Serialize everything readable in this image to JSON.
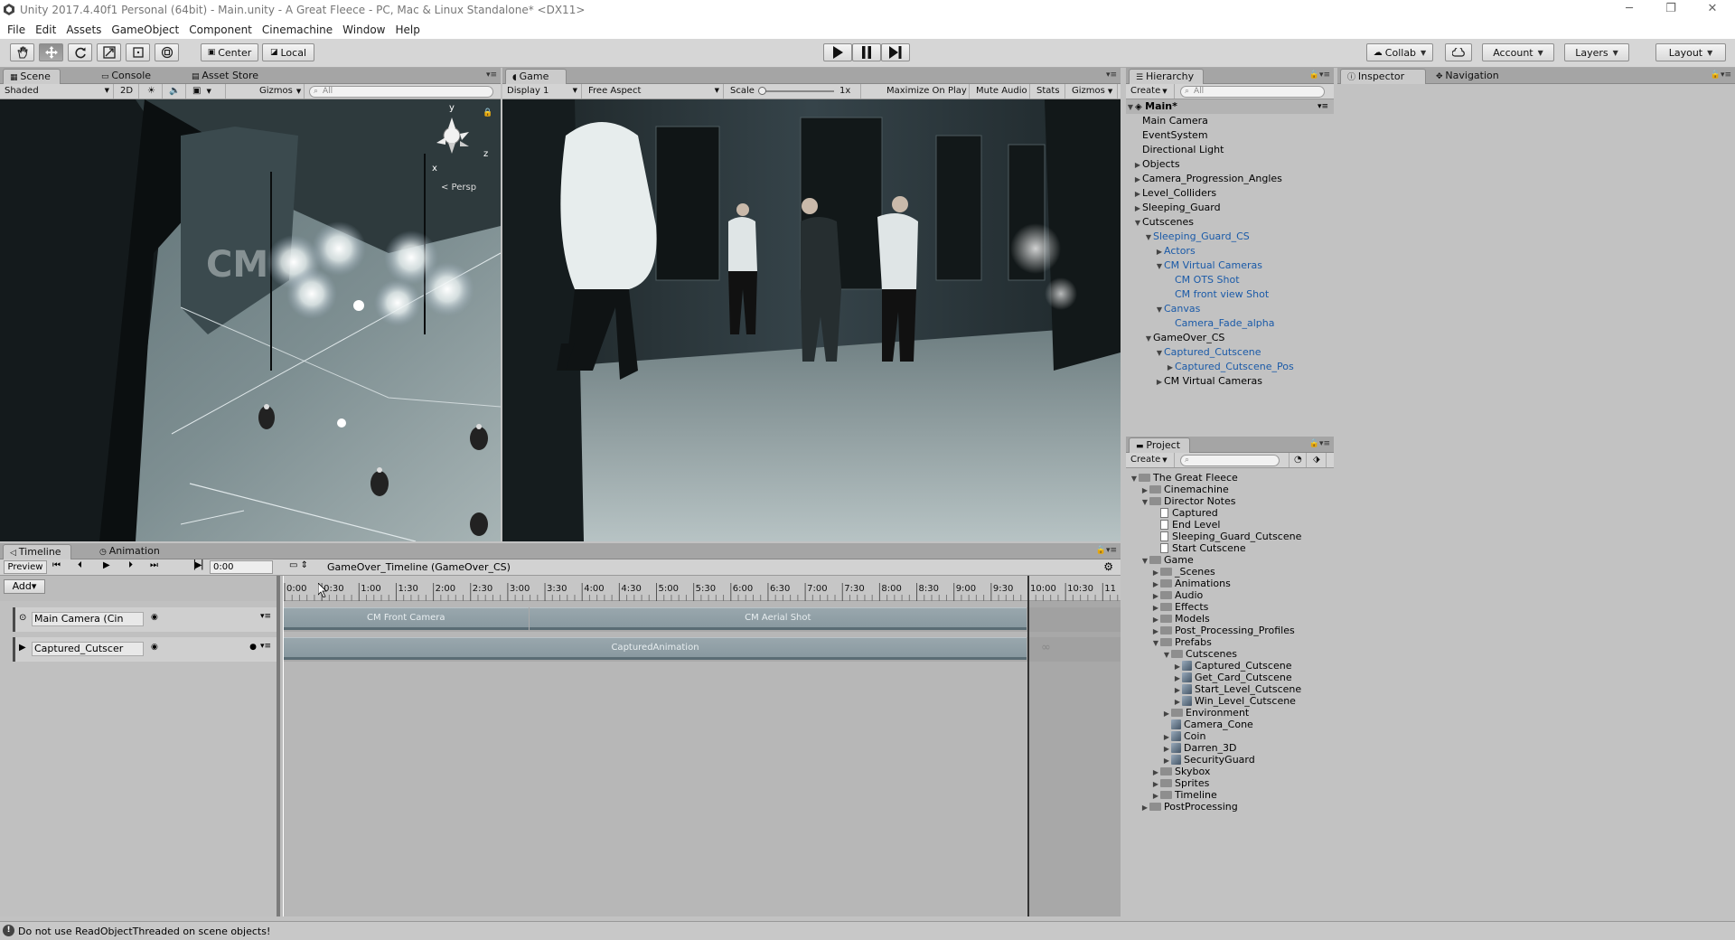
{
  "window": {
    "title": "Unity 2017.4.40f1 Personal (64bit) - Main.unity - A Great Fleece - PC, Mac & Linux Standalone* <DX11>",
    "minimize": "─",
    "restore": "❐",
    "close": "✕"
  },
  "menu": [
    "File",
    "Edit",
    "Assets",
    "GameObject",
    "Component",
    "Cinemachine",
    "Window",
    "Help"
  ],
  "toolbar": {
    "pivot": "Center",
    "space": "Local",
    "collab": "Collab",
    "account": "Account",
    "layers": "Layers",
    "layout": "Layout"
  },
  "scene": {
    "tabs": [
      "Scene",
      "Console",
      "Asset Store"
    ],
    "shading": "Shaded",
    "mode2d": "2D",
    "gizmos": "Gizmos",
    "search": "All",
    "persp": "< Persp",
    "axes": {
      "y": "y",
      "z": "z",
      "x": "x"
    },
    "logo": "CM"
  },
  "game": {
    "tab": "Game",
    "display": "Display 1",
    "aspect": "Free Aspect",
    "scale_label": "Scale",
    "scale_value": "1x",
    "scale_level": 0.05,
    "maximize": "Maximize On Play",
    "mute": "Mute Audio",
    "stats": "Stats",
    "gizmos": "Gizmos"
  },
  "hierarchy": {
    "tab": "Hierarchy",
    "create": "Create",
    "search": "All",
    "scene": "Main*",
    "items": [
      {
        "label": "Main Camera",
        "depth": 0,
        "arrow": "",
        "blue": false
      },
      {
        "label": "EventSystem",
        "depth": 0,
        "arrow": "",
        "blue": false
      },
      {
        "label": "Directional Light",
        "depth": 0,
        "arrow": "",
        "blue": false
      },
      {
        "label": "Objects",
        "depth": 0,
        "arrow": "▶",
        "blue": false
      },
      {
        "label": "Camera_Progression_Angles",
        "depth": 0,
        "arrow": "▶",
        "blue": false
      },
      {
        "label": "Level_Colliders",
        "depth": 0,
        "arrow": "▶",
        "blue": false
      },
      {
        "label": "Sleeping_Guard",
        "depth": 0,
        "arrow": "▶",
        "blue": false
      },
      {
        "label": "Cutscenes",
        "depth": 0,
        "arrow": "▼",
        "blue": false
      },
      {
        "label": "Sleeping_Guard_CS",
        "depth": 1,
        "arrow": "▼",
        "blue": true
      },
      {
        "label": "Actors",
        "depth": 2,
        "arrow": "▶",
        "blue": true
      },
      {
        "label": "CM Virtual Cameras",
        "depth": 2,
        "arrow": "▼",
        "blue": true
      },
      {
        "label": "CM OTS Shot",
        "depth": 3,
        "arrow": "",
        "blue": true
      },
      {
        "label": "CM front view Shot",
        "depth": 3,
        "arrow": "",
        "blue": true
      },
      {
        "label": "Canvas",
        "depth": 2,
        "arrow": "▼",
        "blue": true
      },
      {
        "label": "Camera_Fade_alpha",
        "depth": 3,
        "arrow": "",
        "blue": true
      },
      {
        "label": "GameOver_CS",
        "depth": 1,
        "arrow": "▼",
        "blue": false
      },
      {
        "label": "Captured_Cutscene",
        "depth": 2,
        "arrow": "▼",
        "blue": true
      },
      {
        "label": "Captured_Cutscene_Pos",
        "depth": 3,
        "arrow": "▶",
        "blue": true
      },
      {
        "label": "CM Virtual Cameras",
        "depth": 2,
        "arrow": "▶",
        "blue": false
      }
    ]
  },
  "inspector": {
    "tab": "Inspector",
    "nav_tab": "Navigation"
  },
  "project": {
    "tab": "Project",
    "create": "Create",
    "items": [
      {
        "label": "The Great Fleece",
        "depth": 0,
        "arrow": "▼",
        "icon": "folder"
      },
      {
        "label": "Cinemachine",
        "depth": 1,
        "arrow": "▶",
        "icon": "folder"
      },
      {
        "label": "Director Notes",
        "depth": 1,
        "arrow": "▼",
        "icon": "folder"
      },
      {
        "label": "Captured",
        "depth": 2,
        "arrow": "",
        "icon": "doc"
      },
      {
        "label": "End Level",
        "depth": 2,
        "arrow": "",
        "icon": "doc"
      },
      {
        "label": "Sleeping_Guard_Cutscene",
        "depth": 2,
        "arrow": "",
        "icon": "doc"
      },
      {
        "label": "Start Cutscene",
        "depth": 2,
        "arrow": "",
        "icon": "doc"
      },
      {
        "label": "Game",
        "depth": 1,
        "arrow": "▼",
        "icon": "folder"
      },
      {
        "label": "_Scenes",
        "depth": 2,
        "arrow": "▶",
        "icon": "folder"
      },
      {
        "label": "Animations",
        "depth": 2,
        "arrow": "▶",
        "icon": "folder"
      },
      {
        "label": "Audio",
        "depth": 2,
        "arrow": "▶",
        "icon": "folder"
      },
      {
        "label": "Effects",
        "depth": 2,
        "arrow": "▶",
        "icon": "folder"
      },
      {
        "label": "Models",
        "depth": 2,
        "arrow": "▶",
        "icon": "folder"
      },
      {
        "label": "Post_Processing_Profiles",
        "depth": 2,
        "arrow": "▶",
        "icon": "folder"
      },
      {
        "label": "Prefabs",
        "depth": 2,
        "arrow": "▼",
        "icon": "folder"
      },
      {
        "label": "Cutscenes",
        "depth": 3,
        "arrow": "▼",
        "icon": "folder"
      },
      {
        "label": "Captured_Cutscene",
        "depth": 4,
        "arrow": "▶",
        "icon": "prefab"
      },
      {
        "label": "Get_Card_Cutscene",
        "depth": 4,
        "arrow": "▶",
        "icon": "prefab"
      },
      {
        "label": "Start_Level_Cutscene",
        "depth": 4,
        "arrow": "▶",
        "icon": "prefab"
      },
      {
        "label": "Win_Level_Cutscene",
        "depth": 4,
        "arrow": "▶",
        "icon": "prefab"
      },
      {
        "label": "Environment",
        "depth": 3,
        "arrow": "▶",
        "icon": "folder"
      },
      {
        "label": "Camera_Cone",
        "depth": 3,
        "arrow": "",
        "icon": "prefab"
      },
      {
        "label": "Coin",
        "depth": 3,
        "arrow": "▶",
        "icon": "prefab"
      },
      {
        "label": "Darren_3D",
        "depth": 3,
        "arrow": "▶",
        "icon": "prefab"
      },
      {
        "label": "SecurityGuard",
        "depth": 3,
        "arrow": "▶",
        "icon": "prefab"
      },
      {
        "label": "Skybox",
        "depth": 2,
        "arrow": "▶",
        "icon": "folder"
      },
      {
        "label": "Sprites",
        "depth": 2,
        "arrow": "▶",
        "icon": "folder"
      },
      {
        "label": "Timeline",
        "depth": 2,
        "arrow": "▶",
        "icon": "folder"
      },
      {
        "label": "PostProcessing",
        "depth": 1,
        "arrow": "▶",
        "icon": "folder"
      }
    ]
  },
  "timeline": {
    "tabs": [
      "Timeline",
      "Animation"
    ],
    "preview": "Preview",
    "time": "0:00",
    "asset": "GameOver_Timeline (GameOver_CS)",
    "add": "Add▾",
    "ruler": [
      "0:00",
      "0:30",
      "1:00",
      "1:30",
      "2:00",
      "2:30",
      "3:00",
      "3:30",
      "4:00",
      "4:30",
      "5:00",
      "5:30",
      "6:00",
      "6:30",
      "7:00",
      "7:30",
      "8:00",
      "8:30",
      "9:00",
      "9:30",
      "10:00",
      "10:30",
      "11"
    ],
    "tracks": [
      {
        "label": "Main Camera (Cin",
        "clips": [
          {
            "label": "CM Front Camera",
            "start": 0.0,
            "end": 3.3
          },
          {
            "label": "CM Aerial Shot",
            "start": 3.3,
            "end": 10.0
          }
        ]
      },
      {
        "label": "Captured_Cutscer",
        "clips": [
          {
            "label": "CapturedAnimation",
            "start": 0.0,
            "end": 10.0
          }
        ]
      }
    ],
    "end_marker": 10.0
  },
  "status": {
    "text": "Do not use ReadObjectThreaded on scene objects!"
  }
}
